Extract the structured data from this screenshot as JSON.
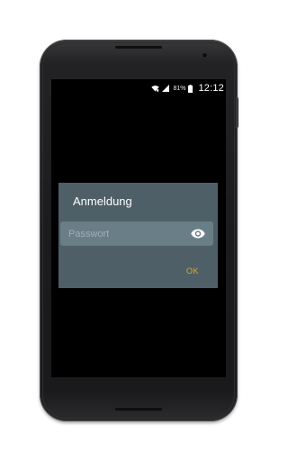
{
  "status_bar": {
    "battery_percent": "81%",
    "time": "12:12",
    "icons": [
      "wifi-icon",
      "signal-icon",
      "battery-icon"
    ]
  },
  "dialog": {
    "title": "Anmeldung",
    "password_placeholder": "Passwort",
    "password_value": "",
    "visibility_icon": "eye-icon",
    "ok_label": "OK"
  },
  "colors": {
    "dialog_bg": "#4e5f67",
    "field_bg": "#6a7e87",
    "accent": "#e3a52c",
    "screen_bg": "#000000"
  }
}
